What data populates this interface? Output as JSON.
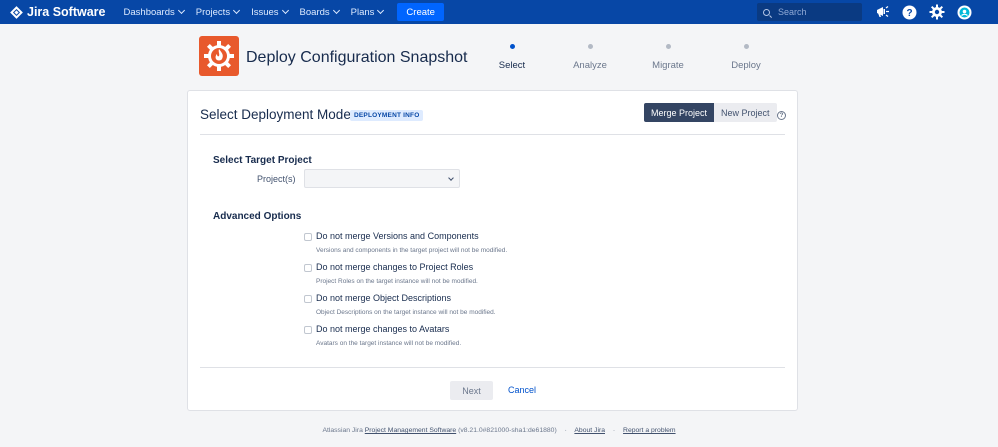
{
  "nav": {
    "logo": "Jira Software",
    "items": [
      {
        "label": "Dashboards"
      },
      {
        "label": "Projects"
      },
      {
        "label": "Issues"
      },
      {
        "label": "Boards"
      },
      {
        "label": "Plans"
      }
    ],
    "create_label": "Create",
    "search_placeholder": "Search"
  },
  "header": {
    "title": "Deploy Configuration Snapshot",
    "steps": [
      {
        "label": "Select",
        "active": true
      },
      {
        "label": "Analyze",
        "active": false
      },
      {
        "label": "Migrate",
        "active": false
      },
      {
        "label": "Deploy",
        "active": false
      }
    ]
  },
  "card": {
    "title": "Select Deployment Mode",
    "badge": "DEPLOYMENT INFO",
    "mode_merge": "Merge Project",
    "mode_new": "New Project",
    "help": "?",
    "target_section": "Select Target Project",
    "projects_label": "Project(s)",
    "projects_value": "",
    "advanced_section": "Advanced Options",
    "options": [
      {
        "label": "Do not merge Versions and Components",
        "desc": "Versions and components in the target project will not be modified."
      },
      {
        "label": "Do not merge changes to Project Roles",
        "desc": "Project Roles on the target instance will not be modified."
      },
      {
        "label": "Do not merge Object Descriptions",
        "desc": "Object Descriptions on the target instance will not be modified."
      },
      {
        "label": "Do not merge changes to Avatars",
        "desc": "Avatars on the target instance will not be modified."
      }
    ],
    "next_label": "Next",
    "cancel_label": "Cancel"
  },
  "footer": {
    "prefix": "Atlassian Jira",
    "pms_link": "Project Management Software",
    "version": "(v8.21.0#821000-sha1:de61880)",
    "sep": "·",
    "about": "About Jira",
    "report": "Report a problem"
  },
  "colors": {
    "nav_bg": "#0747a6",
    "create_bg": "#0065ff",
    "app_icon": "#e8592c",
    "selected_mode": "#344563"
  }
}
